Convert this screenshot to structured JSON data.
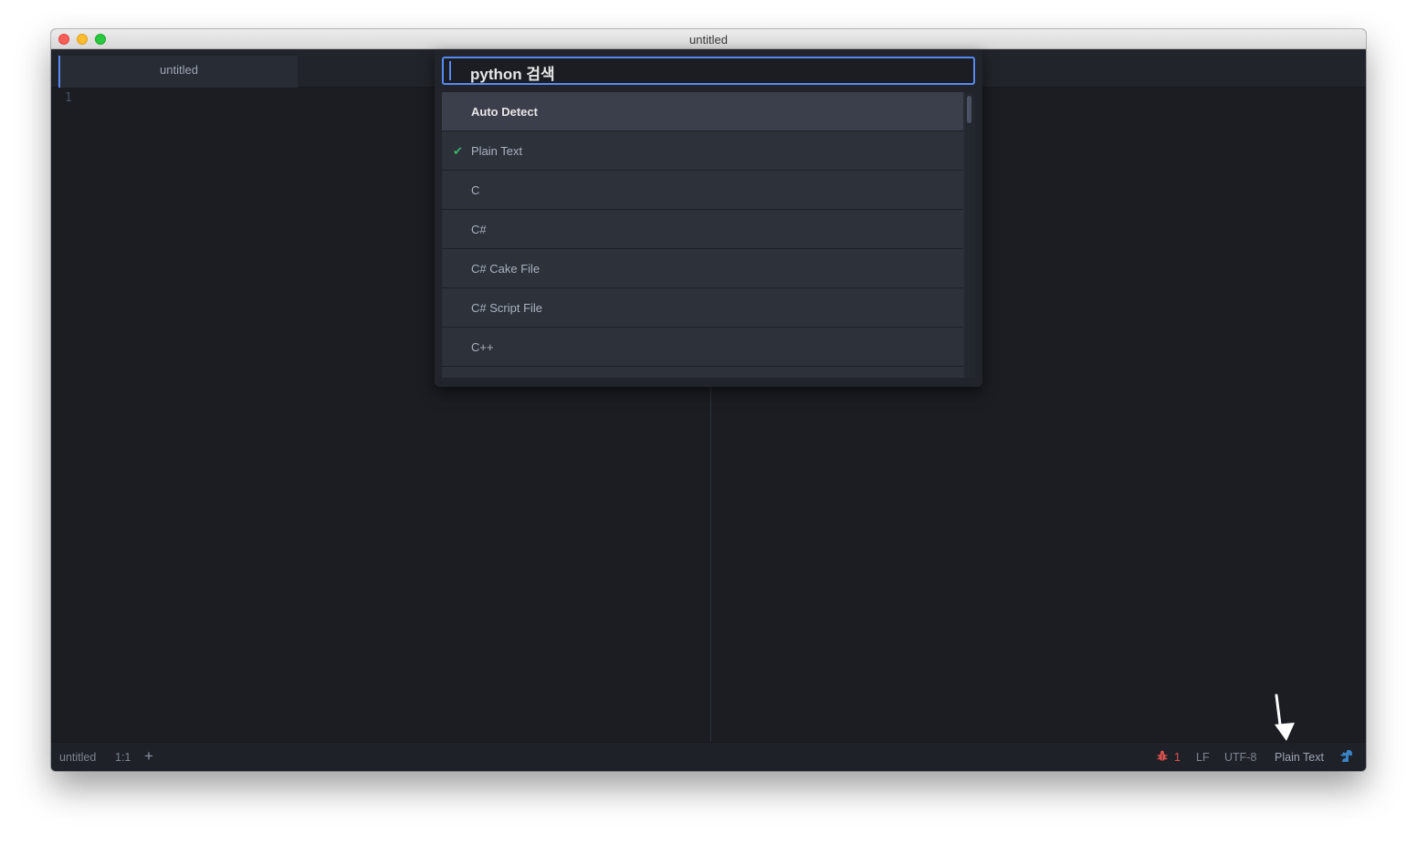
{
  "window": {
    "title": "untitled"
  },
  "tabs": [
    {
      "label": "untitled",
      "active": true
    }
  ],
  "editor": {
    "line_numbers": [
      "1"
    ]
  },
  "command_palette": {
    "search_value": "python 검색",
    "items": [
      {
        "label": "Auto Detect",
        "selected": true,
        "checked": false
      },
      {
        "label": "Plain Text",
        "selected": false,
        "checked": true
      },
      {
        "label": "C",
        "selected": false,
        "checked": false
      },
      {
        "label": "C#",
        "selected": false,
        "checked": false
      },
      {
        "label": "C# Cake File",
        "selected": false,
        "checked": false
      },
      {
        "label": "C# Script File",
        "selected": false,
        "checked": false
      },
      {
        "label": "C++",
        "selected": false,
        "checked": false
      },
      {
        "label": "",
        "selected": false,
        "checked": false
      }
    ],
    "check_glyph": "✔"
  },
  "status_bar": {
    "file_name": "untitled",
    "cursor_position": "1:1",
    "add_glyph": "+",
    "bug_icon": "bug-icon",
    "error_count": "1",
    "line_ending": "LF",
    "encoding": "UTF-8",
    "grammar": "Plain Text",
    "squirrel_icon": "squirrel-icon"
  },
  "colors": {
    "accent": "#568af2",
    "error": "#e05252",
    "check": "#3ab56a",
    "editor_bg": "#1b1d23"
  }
}
